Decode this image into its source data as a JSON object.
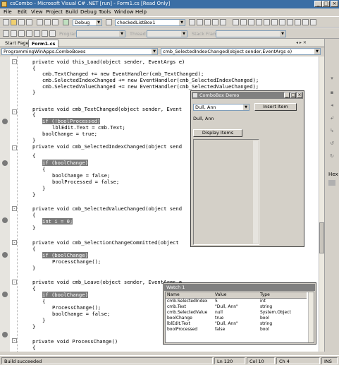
{
  "window": {
    "title": "csCombo - Microsoft Visual C# .NET [run] - Form1.cs [Read Only]"
  },
  "menu": [
    "File",
    "Edit",
    "View",
    "Project",
    "Build",
    "Debug",
    "Tools",
    "Window",
    "Help"
  ],
  "toolbar": {
    "config": "Debug",
    "find_combo": "checkedListBox1",
    "program_label": "Program",
    "thread_label": "Thread",
    "stack_frame_label": "Stack Frame"
  },
  "tabs": [
    "Start Page",
    "Form1.cs"
  ],
  "navigation": {
    "class_combo": "ProgrammingWinApps.ComboBoxes",
    "member_combo": "cmb_SelectedIndexChanged(object sender,EventArgs e)"
  },
  "code_lines": [
    "private void this_Load(object sender, EventArgs e)",
    "{",
    "cmb.TextChanged += new EventHandler(cmb_TextChanged);",
    "cmb.SelectedIndexChanged += new EventHandler(cmb_SelectedIndexChanged);",
    "cmb.SelectedValueChanged += new EventHandler(cmb_SelectedValueChanged);",
    "}",
    "private void cmb_TextChanged(object sender, Event",
    "{",
    "if (!boolProcessed)",
    "lblEdit.Text = cmb.Text;",
    "boolChange = true;",
    "}",
    "private void cmb_SelectedIndexChanged(object send",
    "{",
    "if (boolChange)",
    "{",
    "boolChange = false;",
    "boolProcessed = false;",
    "}",
    "}",
    "private void cmb_SelectedValueChanged(object send",
    "{",
    "int i = 0;",
    "}",
    "private void cmb_SelectionChangeCommitted(object",
    "{",
    "if (boolChange)",
    "ProcessChange();",
    "}",
    "private void cmb_Leave(object sender, EventArgs e",
    "{",
    "if (boolChange)",
    "{",
    "ProcessChange();",
    "boolChange = false;",
    "}",
    "}",
    "private void ProcessChange()",
    "{"
  ],
  "demo_form": {
    "title": "ComboBox Demo",
    "combo_value": "Dull, Ann",
    "insert_button": "Insert Item",
    "label_text": "Dull, Ann",
    "display_button": "Display Items"
  },
  "watch": {
    "title": "Watch 1",
    "headers": [
      "Name",
      "Value",
      "Type"
    ],
    "rows": [
      [
        "cmb.SelectedIndex",
        "5",
        "int"
      ],
      [
        "cmb.Text",
        "\"Dull, Ann\"",
        "string"
      ],
      [
        "cmb.SelectedValue",
        "null",
        "System.Object"
      ],
      [
        "boolChange",
        "true",
        "bool"
      ],
      [
        "lblEdit.Text",
        "\"Dull, Ann\"",
        "string"
      ],
      [
        "boolProcessed",
        "false",
        "bool"
      ]
    ]
  },
  "status": {
    "message": "Build succeeded",
    "line": "Ln 120",
    "col": "Col 10",
    "ch": "Ch 4",
    "mode": "INS"
  }
}
